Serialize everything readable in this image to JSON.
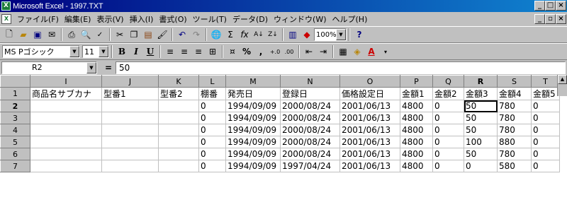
{
  "window": {
    "title": "Microsoft Excel - 1997.TXT",
    "min": "_",
    "max": "□",
    "close": "×"
  },
  "menu": [
    "ファイル(F)",
    "編集(E)",
    "表示(V)",
    "挿入(I)",
    "書式(O)",
    "ツール(T)",
    "データ(D)",
    "ウィンドウ(W)",
    "ヘルプ(H)"
  ],
  "doc_buttons": {
    "min": "_",
    "restore": "ｇ",
    "close": "×"
  },
  "toolbar1": {
    "zoom": "100%",
    "help": "?"
  },
  "toolbar2": {
    "font": "MS Pゴシック",
    "size": "11",
    "bold": "B",
    "italic": "I",
    "underline": "U",
    "currency": "%",
    "comma": ","
  },
  "formula": {
    "cell_ref": "R2",
    "equals": "=",
    "value": "50"
  },
  "columns": [
    "I",
    "J",
    "K",
    "L",
    "M",
    "N",
    "O",
    "P",
    "Q",
    "R",
    "S",
    "T"
  ],
  "selected_column": "R",
  "rows": [
    {
      "num": "1",
      "cells": [
        "商品名サブカナ",
        "型番1",
        "型番2",
        "棚番",
        "発売日",
        "登録日",
        "価格設定日",
        "金額1",
        "金額2",
        "金額3",
        "金額4",
        "金額5"
      ]
    },
    {
      "num": "2",
      "cells": [
        "",
        "",
        "",
        "0",
        "1994/09/09",
        "2000/08/24",
        "2001/06/13",
        "4800",
        "0",
        "50",
        "780",
        "0"
      ]
    },
    {
      "num": "3",
      "cells": [
        "",
        "",
        "",
        "0",
        "1994/09/09",
        "2000/08/24",
        "2001/06/13",
        "4800",
        "0",
        "50",
        "780",
        "0"
      ]
    },
    {
      "num": "4",
      "cells": [
        "",
        "",
        "",
        "0",
        "1994/09/09",
        "2000/08/24",
        "2001/06/13",
        "4800",
        "0",
        "50",
        "780",
        "0"
      ]
    },
    {
      "num": "5",
      "cells": [
        "",
        "",
        "",
        "0",
        "1994/09/09",
        "2000/08/24",
        "2001/06/13",
        "4800",
        "0",
        "100",
        "880",
        "0"
      ]
    },
    {
      "num": "6",
      "cells": [
        "",
        "",
        "",
        "0",
        "1994/09/09",
        "2000/08/24",
        "2001/06/13",
        "4800",
        "0",
        "50",
        "780",
        "0"
      ]
    },
    {
      "num": "7",
      "cells": [
        "",
        "",
        "",
        "0",
        "1994/09/09",
        "1997/04/24",
        "2001/06/13",
        "4800",
        "0",
        "0",
        "580",
        "0"
      ]
    }
  ]
}
